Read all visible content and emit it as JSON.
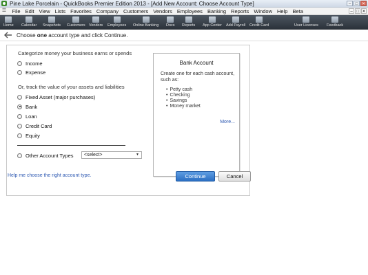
{
  "window": {
    "title": "Pine Lake Porcelain  - QuickBooks Premier Edition 2013 - [Add New Account: Choose Account Type]",
    "controls": [
      "minimize",
      "maximize",
      "close"
    ]
  },
  "menubar": {
    "items": [
      "File",
      "Edit",
      "View",
      "Lists",
      "Favorites",
      "Company",
      "Customers",
      "Vendors",
      "Employees",
      "Banking",
      "Reports",
      "Window",
      "Help",
      "Beta"
    ]
  },
  "iconbar": {
    "items": [
      "Home",
      "Calendar",
      "Snapshots",
      "Customers",
      "Vendors",
      "Employees",
      "Online Banking",
      "Docs",
      "Reports",
      "App Center",
      "Add Payroll",
      "Credit Card",
      "User Licenses",
      "Feedback"
    ]
  },
  "dialog": {
    "instruction_prefix": "Choose ",
    "instruction_bold": "one",
    "instruction_suffix": " account type and click Continue.",
    "section1_heading": "Categorize money your business earns or spends",
    "section2_heading": "Or, track the value of your assets and liabilities",
    "options": {
      "income": "Income",
      "expense": "Expense",
      "fixed_asset": "Fixed Asset (major purchases)",
      "bank": "Bank",
      "loan": "Loan",
      "credit_card": "Credit Card",
      "equity": "Equity",
      "other": "Other Account Types"
    },
    "selected_option": "bank",
    "other_select_value": "<select>",
    "info": {
      "title": "Bank Account",
      "description": "Create one for each cash account, such as:",
      "items": [
        "Petty cash",
        "Checking",
        "Savings",
        "Money market"
      ],
      "more_link": "More..."
    },
    "help_link": "Help me choose the right account type.",
    "continue_label": "Continue",
    "cancel_label": "Cancel"
  },
  "colors": {
    "accent": "#2c6fc2",
    "link": "#2a56b0",
    "iconbar_bg": "#2b323a"
  }
}
